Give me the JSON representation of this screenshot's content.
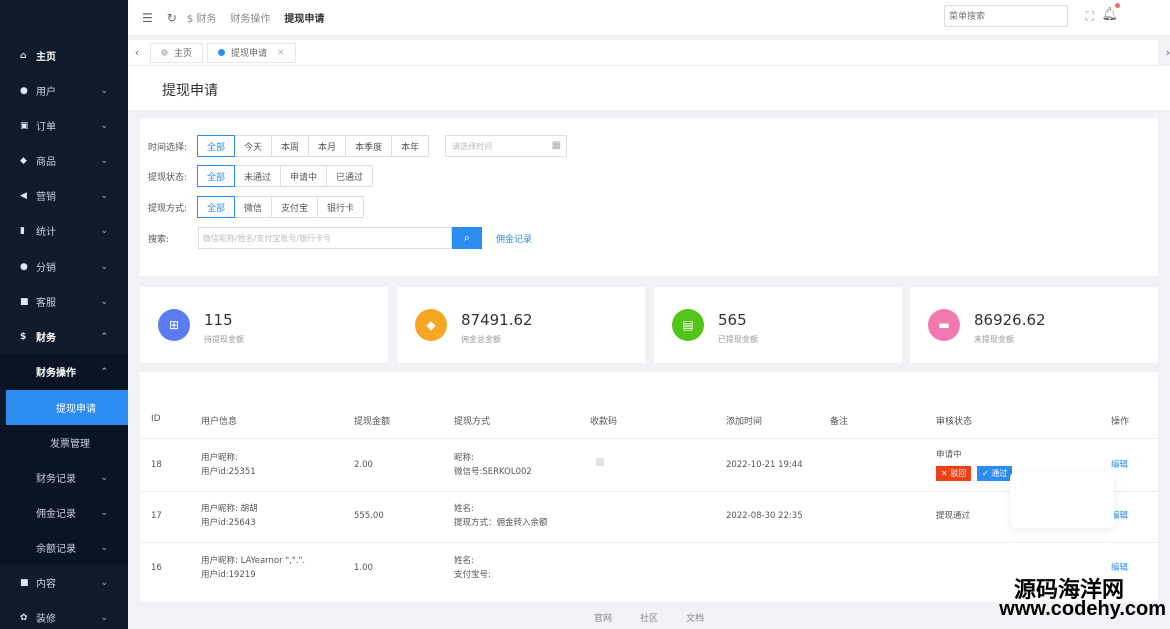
{
  "sidebar": {
    "items": [
      {
        "icon": "home-icon",
        "glyph": "⌂",
        "label": "主页"
      },
      {
        "icon": "user-icon",
        "glyph": "●",
        "label": "用户"
      },
      {
        "icon": "cart-icon",
        "glyph": "▣",
        "label": "订单"
      },
      {
        "icon": "goods-icon",
        "glyph": "◆",
        "label": "商品"
      },
      {
        "icon": "marketing-icon",
        "glyph": "◀",
        "label": "营销"
      },
      {
        "icon": "stats-icon",
        "glyph": "▮",
        "label": "统计"
      },
      {
        "icon": "distribution-icon",
        "glyph": "●",
        "label": "分销"
      },
      {
        "icon": "service-icon",
        "glyph": "■",
        "label": "客服"
      },
      {
        "icon": "finance-icon",
        "glyph": "$",
        "label": "财务"
      }
    ],
    "finance_ops": "财务操作",
    "withdraw_apply": "提现申请",
    "invoice_manage": "发票管理",
    "finance_record": "财务记录",
    "commission_record": "佣金记录",
    "balance_record": "余额记录",
    "content": "内容",
    "decorate": "装修"
  },
  "header": {
    "crumb_finance": "财务",
    "crumb_ops": "财务操作",
    "crumb_current": "提现申请",
    "search_placeholder": "菜单搜索"
  },
  "tabs": {
    "home": "主页",
    "current": "提现申请"
  },
  "page": {
    "title": "提现申请"
  },
  "filter": {
    "time_label": "时间选择:",
    "time_opts": [
      "全部",
      "今天",
      "本周",
      "本月",
      "本季度",
      "本年"
    ],
    "date_placeholder": "请选择时间",
    "status_label": "提现状态:",
    "status_opts": [
      "全部",
      "未通过",
      "申请中",
      "已通过"
    ],
    "method_label": "提现方式:",
    "method_opts": [
      "全部",
      "微信",
      "支付宝",
      "银行卡"
    ],
    "search_label": "搜索:",
    "search_placeholder": "微信昵称/姓名/支付宝账号/银行卡号",
    "commission_link": "佣金记录"
  },
  "stats": [
    {
      "value": "115",
      "label": "待提现金额",
      "color": "#5b7bf0",
      "icon": "basket-icon",
      "glyph": "⊞"
    },
    {
      "value": "87491.62",
      "label": "佣金总金额",
      "color": "#f5a623",
      "icon": "tag-icon",
      "glyph": "◆"
    },
    {
      "value": "565",
      "label": "已提现金额",
      "color": "#52c41a",
      "icon": "cash-icon",
      "glyph": "▤"
    },
    {
      "value": "86926.62",
      "label": "未提现金额",
      "color": "#f07ab0",
      "icon": "card-icon",
      "glyph": "▬"
    }
  ],
  "table": {
    "headers": [
      "ID",
      "用户信息",
      "提现金额",
      "提现方式",
      "收款码",
      "添加时间",
      "备注",
      "审核状态",
      "操作"
    ],
    "rows": [
      {
        "id": "18",
        "user1": "用户昵称:",
        "user2": "用户id:25351",
        "amount": "2.00",
        "m1": "昵称:",
        "m2": "微信号:SERKOL002",
        "time": "2022-10-21 19:44",
        "status": "申请中",
        "edit": "编辑"
      },
      {
        "id": "17",
        "user1": "用户昵称: 胡胡",
        "user2": "用户id:25643",
        "amount": "555.00",
        "m1": "姓名:",
        "m2": "提现方式：佣金转入余额",
        "time": "2022-08-30 22:35",
        "status": "提现通过",
        "edit": "编辑"
      },
      {
        "id": "16",
        "user1": "用户昵称: LAYearnor \",\".\".",
        "user2": "用户id:19219",
        "amount": "1.00",
        "m1": "姓名:",
        "m2": "支付宝号:",
        "time": "",
        "status": "",
        "edit": "编辑"
      }
    ],
    "reject": "驳回",
    "approve": "通过"
  },
  "footer": {
    "links": [
      "官网",
      "社区",
      "文档"
    ]
  },
  "watermark": {
    "cn": "源码海洋网",
    "url": "www.codehy.com"
  }
}
